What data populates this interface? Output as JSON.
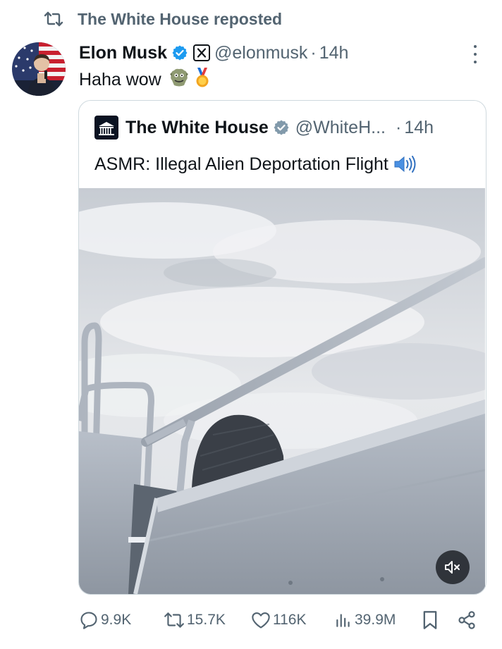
{
  "repost": {
    "label": "The White House reposted",
    "icon": "repost-icon"
  },
  "tweet": {
    "author_name": "Elon Musk",
    "handle": "@elonmusk",
    "separator": "·",
    "time": "14h",
    "text": "Haha wow",
    "emojis": [
      "troll-face",
      "medal"
    ]
  },
  "quote": {
    "author_name": "The White House",
    "handle": "@WhiteH...",
    "separator": "·",
    "time": "14h",
    "text": "ASMR: Illegal Alien Deportation Flight",
    "text_icon": "speaker-loud"
  },
  "media": {
    "muted": true,
    "mute_icon": "speaker-muted-icon"
  },
  "actions": {
    "replies": "9.9K",
    "reposts": "15.7K",
    "likes": "116K",
    "views": "39.9M"
  },
  "colors": {
    "verified": "#1d9bf0",
    "secondary_text": "#536471",
    "border": "#cfd9de",
    "primary_text": "#0f1419"
  }
}
